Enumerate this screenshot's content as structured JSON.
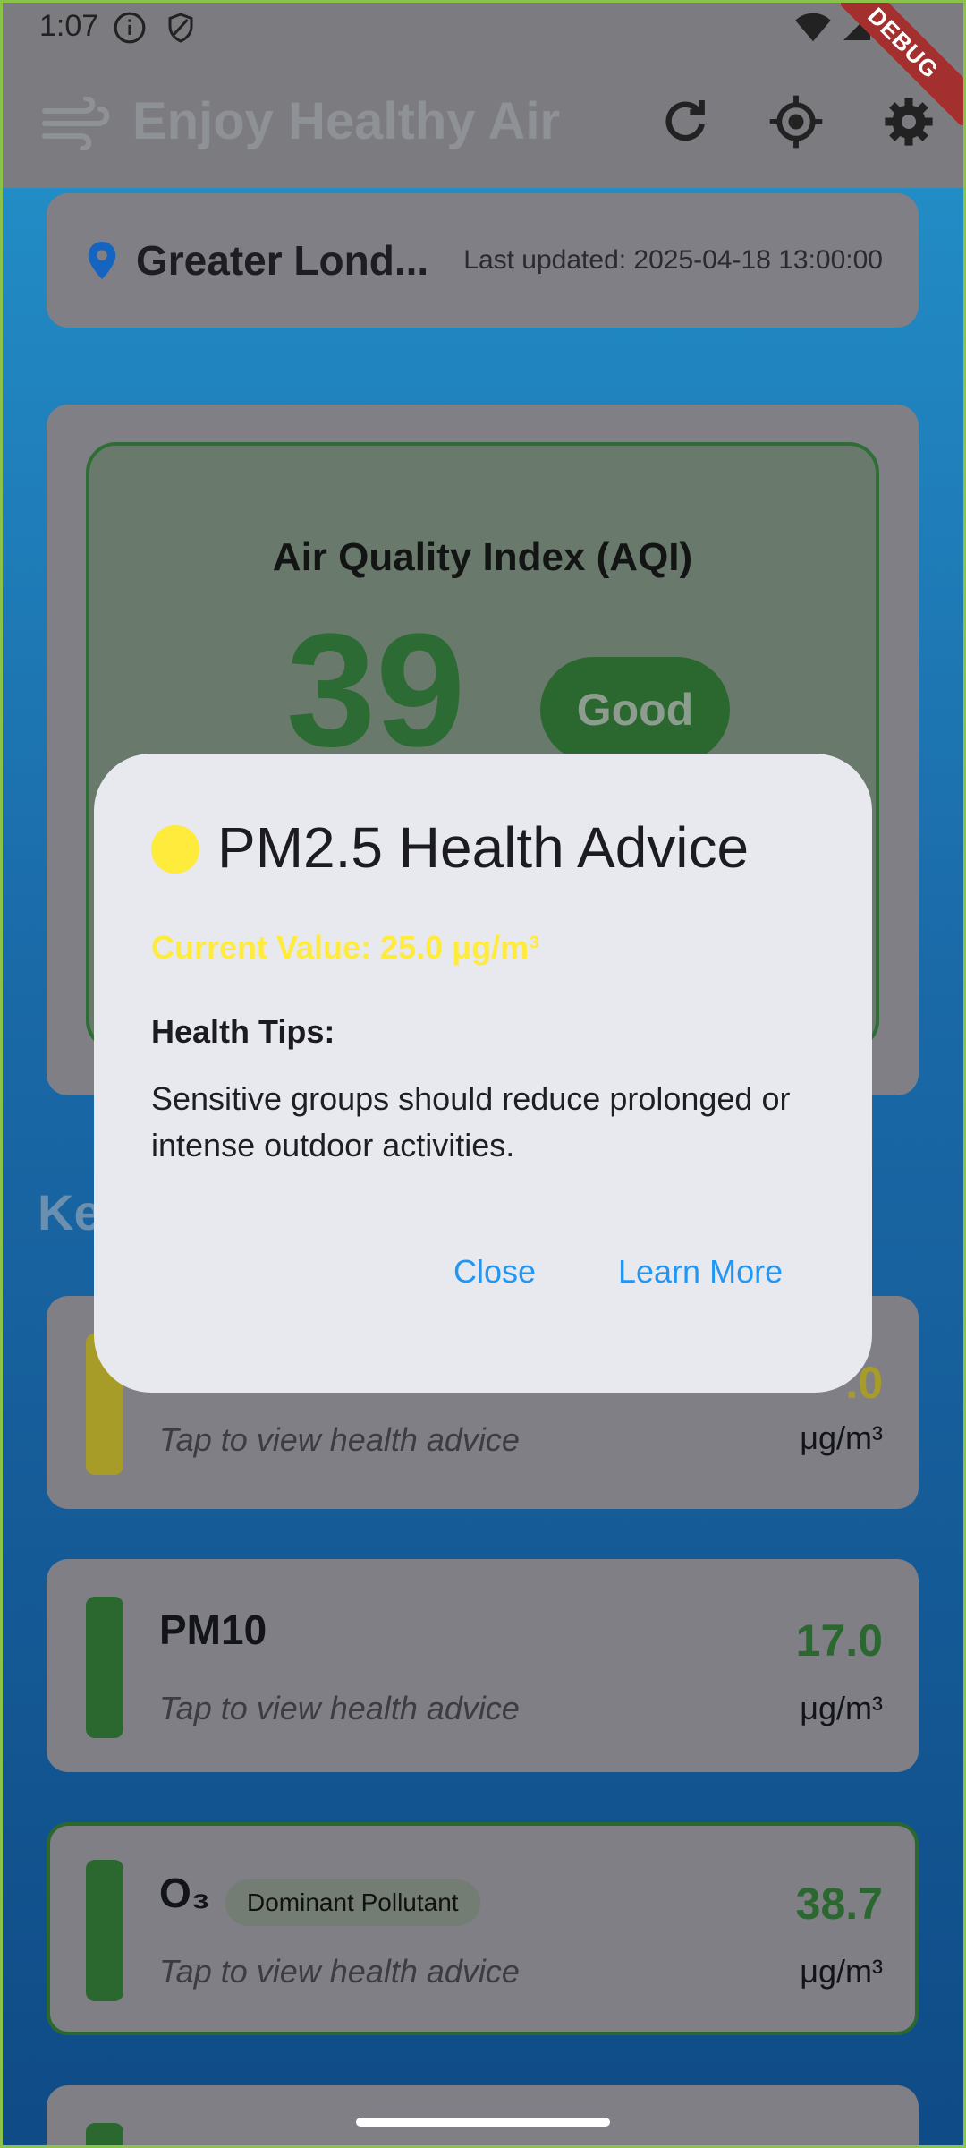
{
  "status_bar": {
    "time": "1:07"
  },
  "app_bar": {
    "title": "Enjoy Healthy Air",
    "debug_label": "DEBUG"
  },
  "location": {
    "name": "Greater Lond...",
    "last_updated": "Last updated: 2025-04-18 13:00:00"
  },
  "aqi": {
    "title": "Air Quality Index (AQI)",
    "value": "39",
    "category": "Good",
    "accent": "#2e7d32"
  },
  "section": {
    "title_partial": "Ke"
  },
  "pollutants": [
    {
      "name": "",
      "hint": "Tap to view health advice",
      "value_partial": ".0",
      "unit": "μg/m³",
      "color": "#c0b22a"
    },
    {
      "name": "PM10",
      "hint": "Tap to view health advice",
      "value": "17.0",
      "unit": "μg/m³",
      "color": "#2e7d32"
    },
    {
      "name": "O₃",
      "badge": "Dominant Pollutant",
      "hint": "Tap to view health advice",
      "value": "38.7",
      "unit": "μg/m³",
      "color": "#2e7d32"
    }
  ],
  "dialog": {
    "title": "PM2.5 Health Advice",
    "current_value": "Current Value: 25.0 μg/m³",
    "tips_label": "Health Tips:",
    "tips_text": "Sensitive groups should reduce prolonged or intense outdoor activities.",
    "close_label": "Close",
    "learn_more_label": "Learn More",
    "indicator_color": "#ffeb3b"
  }
}
